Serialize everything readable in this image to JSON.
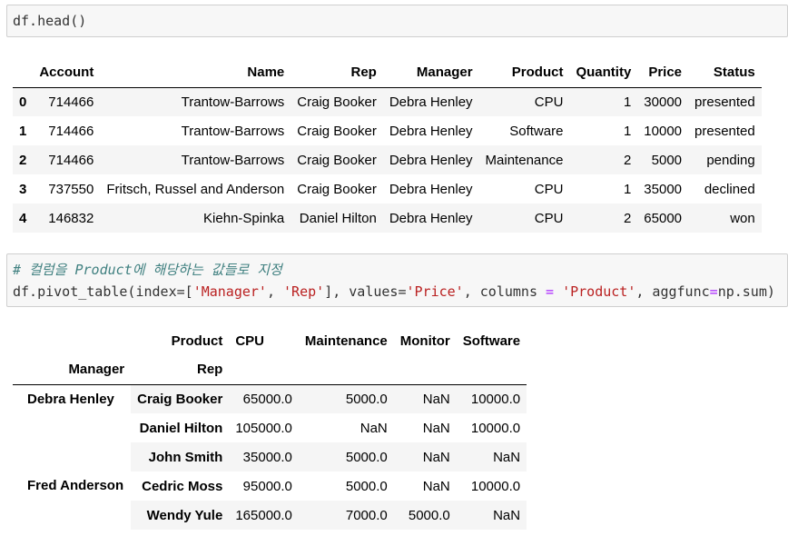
{
  "cells": [
    {
      "code": "df.head()"
    },
    {
      "comment": "# 컬럼을 Product에 해당하는 값들로 지정",
      "code_parts": [
        "df.pivot_table(index=[",
        "'Manager'",
        ", ",
        "'Rep'",
        "], values=",
        "'Price'",
        ", columns ",
        "=",
        " ",
        "'Product'",
        ", aggfunc",
        "=",
        "np.sum)"
      ]
    }
  ],
  "head_table": {
    "columns": [
      "Account",
      "Name",
      "Rep",
      "Manager",
      "Product",
      "Quantity",
      "Price",
      "Status"
    ],
    "rows": [
      {
        "index": "0",
        "values": [
          "714466",
          "Trantow-Barrows",
          "Craig Booker",
          "Debra Henley",
          "CPU",
          "1",
          "30000",
          "presented"
        ]
      },
      {
        "index": "1",
        "values": [
          "714466",
          "Trantow-Barrows",
          "Craig Booker",
          "Debra Henley",
          "Software",
          "1",
          "10000",
          "presented"
        ]
      },
      {
        "index": "2",
        "values": [
          "714466",
          "Trantow-Barrows",
          "Craig Booker",
          "Debra Henley",
          "Maintenance",
          "2",
          "5000",
          "pending"
        ]
      },
      {
        "index": "3",
        "values": [
          "737550",
          "Fritsch, Russel and Anderson",
          "Craig Booker",
          "Debra Henley",
          "CPU",
          "1",
          "35000",
          "declined"
        ]
      },
      {
        "index": "4",
        "values": [
          "146832",
          "Kiehn-Spinka",
          "Daniel Hilton",
          "Debra Henley",
          "CPU",
          "2",
          "65000",
          "won"
        ]
      }
    ]
  },
  "pivot_table": {
    "columns_name": "Product",
    "index_names": [
      "Manager",
      "Rep"
    ],
    "columns": [
      "CPU",
      "Maintenance",
      "Monitor",
      "Software"
    ],
    "groups": [
      {
        "manager": "Debra Henley",
        "rows": [
          {
            "rep": "Craig Booker",
            "values": [
              "65000.0",
              "5000.0",
              "NaN",
              "10000.0"
            ]
          },
          {
            "rep": "Daniel Hilton",
            "values": [
              "105000.0",
              "NaN",
              "NaN",
              "10000.0"
            ]
          },
          {
            "rep": "John Smith",
            "values": [
              "35000.0",
              "5000.0",
              "NaN",
              "NaN"
            ]
          }
        ]
      },
      {
        "manager": "Fred Anderson",
        "rows": [
          {
            "rep": "Cedric Moss",
            "values": [
              "95000.0",
              "5000.0",
              "NaN",
              "10000.0"
            ]
          },
          {
            "rep": "Wendy Yule",
            "values": [
              "165000.0",
              "7000.0",
              "5000.0",
              "NaN"
            ]
          }
        ]
      }
    ]
  }
}
